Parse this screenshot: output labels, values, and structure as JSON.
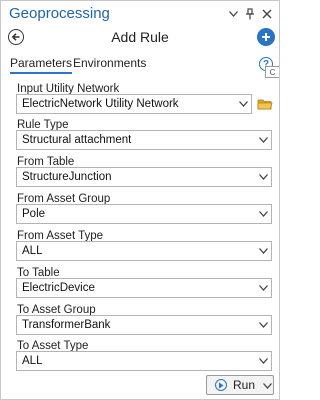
{
  "window": {
    "title": "Geoprocessing"
  },
  "header": {
    "title": "Add Rule"
  },
  "tabs": [
    {
      "label": "Parameters"
    },
    {
      "label": "Environments"
    }
  ],
  "fields": [
    {
      "label": "Input Utility Network",
      "value": "ElectricNetwork Utility Network"
    },
    {
      "label": "Rule Type",
      "value": "Structural attachment"
    },
    {
      "label": "From Table",
      "value": "StructureJunction"
    },
    {
      "label": "From Asset Group",
      "value": "Pole"
    },
    {
      "label": "From Asset Type",
      "value": "ALL"
    },
    {
      "label": "To Table",
      "value": "ElectricDevice"
    },
    {
      "label": "To Asset Group",
      "value": "TransformerBank"
    },
    {
      "label": "To Asset Type",
      "value": "ALL"
    }
  ],
  "run_button": {
    "label": "Run"
  },
  "colors": {
    "title_blue": "#1f63a6",
    "accent_blue": "#2a74c5",
    "folder_yellow": "#e0a526"
  },
  "icons": [
    "dropdown-icon",
    "pin-icon",
    "close-icon",
    "back-icon",
    "add-icon",
    "help-icon",
    "folder-icon",
    "run-icon",
    "chevron-down-icon"
  ]
}
